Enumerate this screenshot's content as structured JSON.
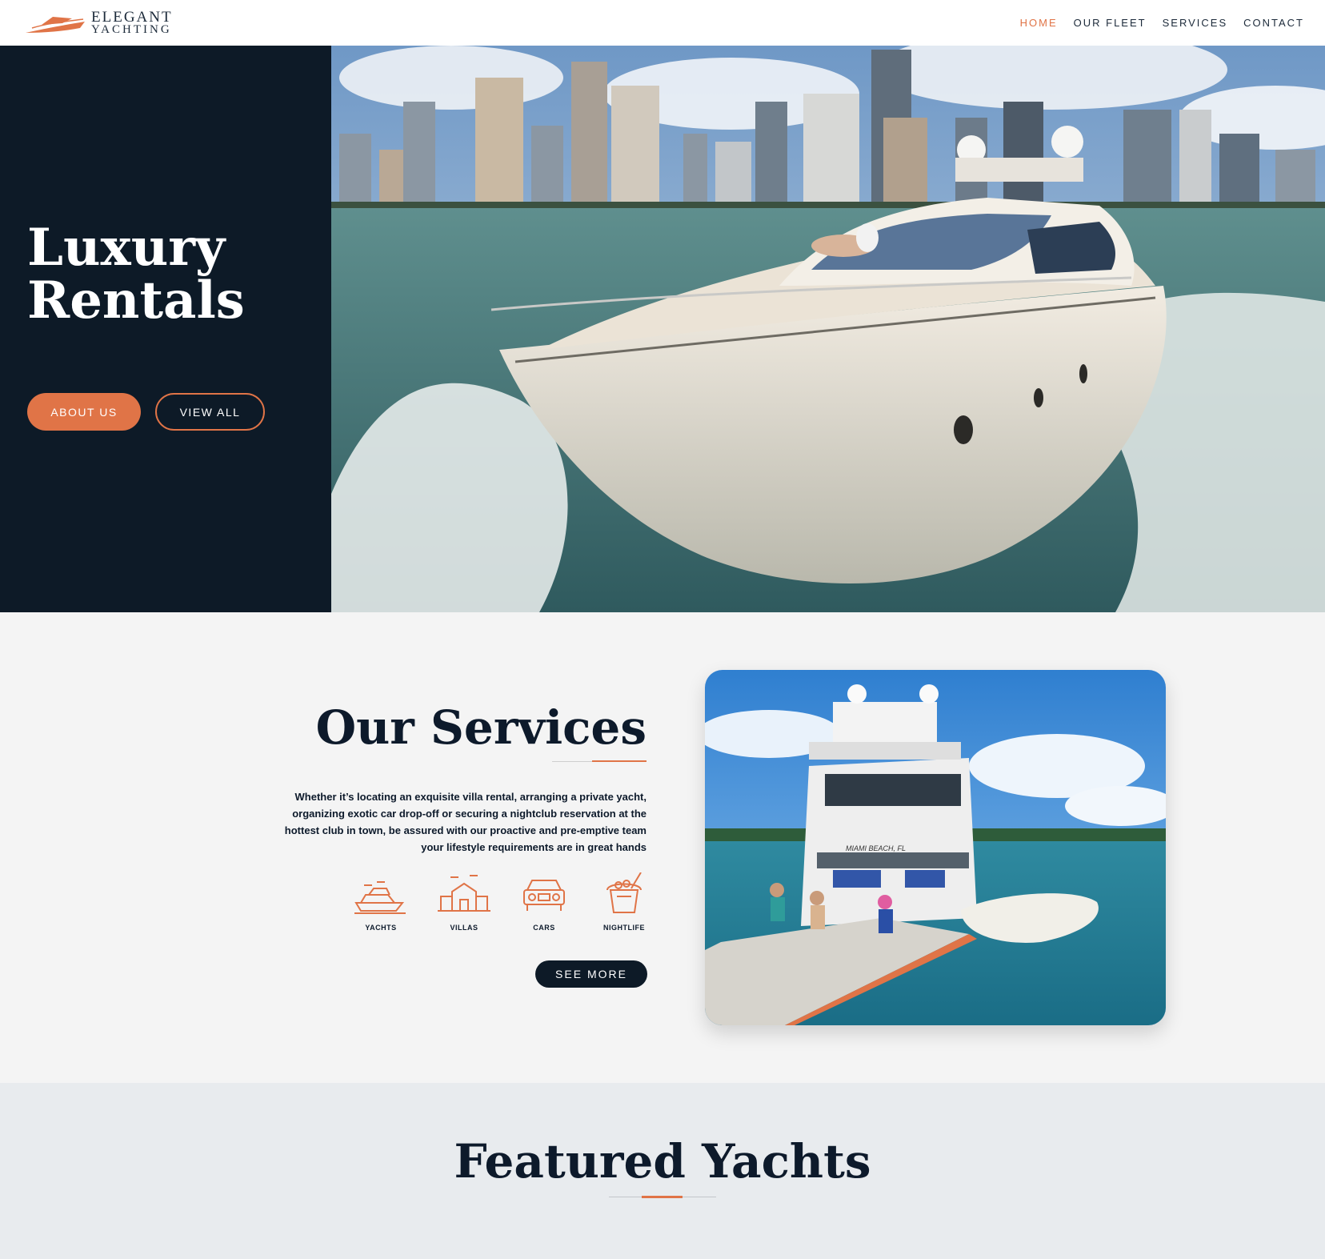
{
  "header": {
    "logo_line1": "ELEGANT",
    "logo_line2": "YACHTING",
    "nav": [
      {
        "label": "HOME",
        "active": true
      },
      {
        "label": "OUR FLEET",
        "active": false
      },
      {
        "label": "SERVICES",
        "active": false
      },
      {
        "label": "CONTACT",
        "active": false
      }
    ]
  },
  "hero": {
    "title": "Luxury\nRentals",
    "about_button": "ABOUT US",
    "view_button": "VIEW ALL"
  },
  "services": {
    "title": "Our Services",
    "description": "Whether it’s locating an exquisite villa rental, arranging a private yacht, organizing exotic car drop-off or securing a nightclub reservation at the hottest club in town, be assured with our proactive and pre-emptive team your lifestyle requirements are in great hands",
    "icons": [
      {
        "label": "YACHTS",
        "icon": "yacht-icon"
      },
      {
        "label": "VILLAS",
        "icon": "villa-icon"
      },
      {
        "label": "CARS",
        "icon": "car-icon"
      },
      {
        "label": "NIGHTLIFE",
        "icon": "champagne-bucket-icon"
      }
    ],
    "see_more": "SEE MORE",
    "image_caption": "MIAMI BEACH, FL"
  },
  "featured": {
    "title": "Featured Yachts"
  },
  "colors": {
    "accent": "#e07447",
    "navy": "#0d1a27",
    "services_bg": "#f4f4f4",
    "featured_bg": "#e8ebee"
  }
}
